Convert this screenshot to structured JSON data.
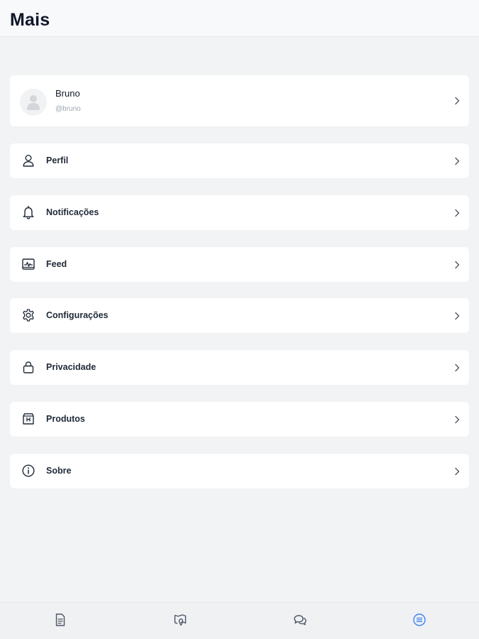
{
  "header": {
    "title": "Mais"
  },
  "profile": {
    "name": "Bruno",
    "handle": "@bruno"
  },
  "menu": {
    "items": [
      {
        "label": "Perfil",
        "icon": "user-icon"
      },
      {
        "label": "Notificações",
        "icon": "bell-icon"
      },
      {
        "label": "Feed",
        "icon": "activity-monitor-icon"
      },
      {
        "label": "Configurações",
        "icon": "gear-icon"
      },
      {
        "label": "Privacidade",
        "icon": "lock-icon"
      },
      {
        "label": "Produtos",
        "icon": "store-icon"
      },
      {
        "label": "Sobre",
        "icon": "info-icon"
      }
    ]
  },
  "tabbar": {
    "tabs": [
      {
        "icon": "document-icon",
        "active": false
      },
      {
        "icon": "map-pin-icon",
        "active": false
      },
      {
        "icon": "chat-bubbles-icon",
        "active": false
      },
      {
        "icon": "menu-list-icon",
        "active": true
      }
    ],
    "active_color": "#3b82f6",
    "inactive_color": "#4b5563"
  }
}
